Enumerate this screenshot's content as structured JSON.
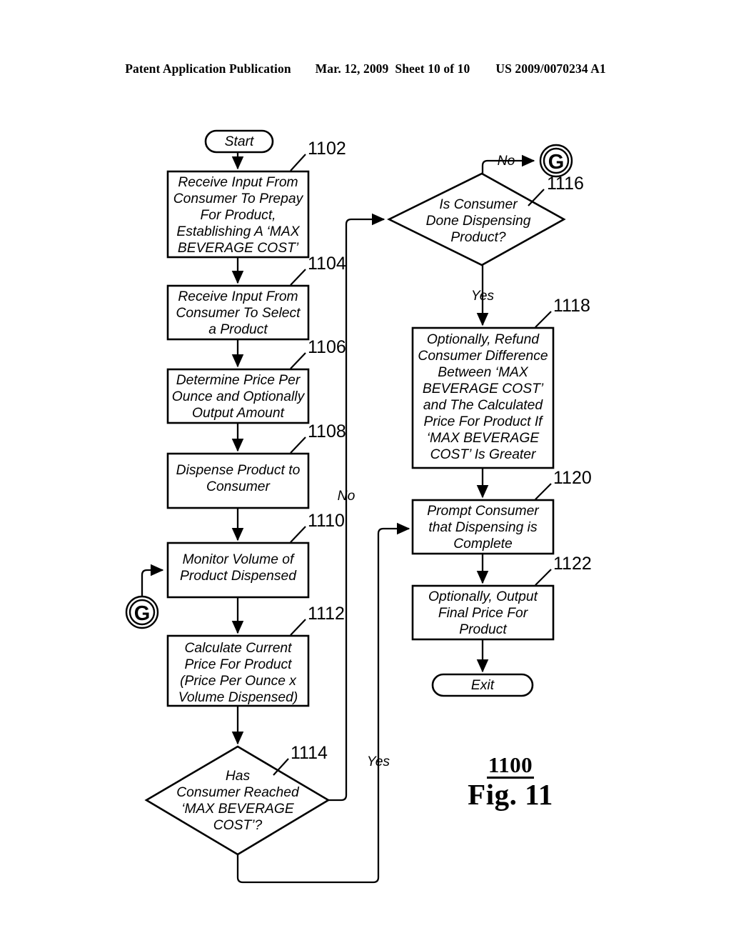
{
  "header": {
    "publication": "Patent Application Publication",
    "date": "Mar. 12, 2009",
    "sheet": "Sheet 10 of 10",
    "patent_number": "US 2009/0070234 A1"
  },
  "figure": {
    "reference_numeral": "1100",
    "label": "Fig. 11"
  },
  "flowchart": {
    "start": {
      "label": "Start"
    },
    "exit": {
      "label": "Exit"
    },
    "connector_label": "G",
    "nodes": [
      {
        "ref": "1102",
        "type": "process",
        "lines": [
          "Receive Input From",
          "Consumer To Prepay",
          "For Product,",
          "Establishing A ‘MAX",
          "BEVERAGE COST’"
        ]
      },
      {
        "ref": "1104",
        "type": "process",
        "lines": [
          "Receive Input From",
          "Consumer To Select",
          "a Product"
        ]
      },
      {
        "ref": "1106",
        "type": "process",
        "lines": [
          "Determine Price Per",
          "Ounce and Optionally",
          "Output Amount"
        ]
      },
      {
        "ref": "1108",
        "type": "process",
        "lines": [
          "Dispense Product to",
          "Consumer"
        ]
      },
      {
        "ref": "1110",
        "type": "process",
        "lines": [
          "Monitor Volume of",
          "Product Dispensed"
        ]
      },
      {
        "ref": "1112",
        "type": "process",
        "lines": [
          "Calculate Current",
          "Price For Product",
          "(Price Per Ounce x",
          "Volume Dispensed)"
        ]
      },
      {
        "ref": "1114",
        "type": "decision",
        "lines": [
          "Has",
          "Consumer Reached",
          "‘MAX BEVERAGE",
          "COST’?"
        ]
      },
      {
        "ref": "1116",
        "type": "decision",
        "lines": [
          "Is Consumer",
          "Done Dispensing",
          "Product?"
        ]
      },
      {
        "ref": "1118",
        "type": "process",
        "lines": [
          "Optionally, Refund",
          "Consumer Difference",
          "Between ‘MAX",
          "BEVERAGE COST’",
          "and The Calculated",
          "Price For Product If",
          "‘MAX BEVERAGE",
          "COST’ Is Greater"
        ]
      },
      {
        "ref": "1120",
        "type": "process",
        "lines": [
          "Prompt Consumer",
          "that Dispensing is",
          "Complete"
        ]
      },
      {
        "ref": "1122",
        "type": "process",
        "lines": [
          "Optionally, Output",
          "Final Price For",
          "Product"
        ]
      }
    ],
    "edge_labels": {
      "no_1114": "No",
      "yes_1114": "Yes",
      "no_1116": "No",
      "yes_1116": "Yes"
    }
  }
}
